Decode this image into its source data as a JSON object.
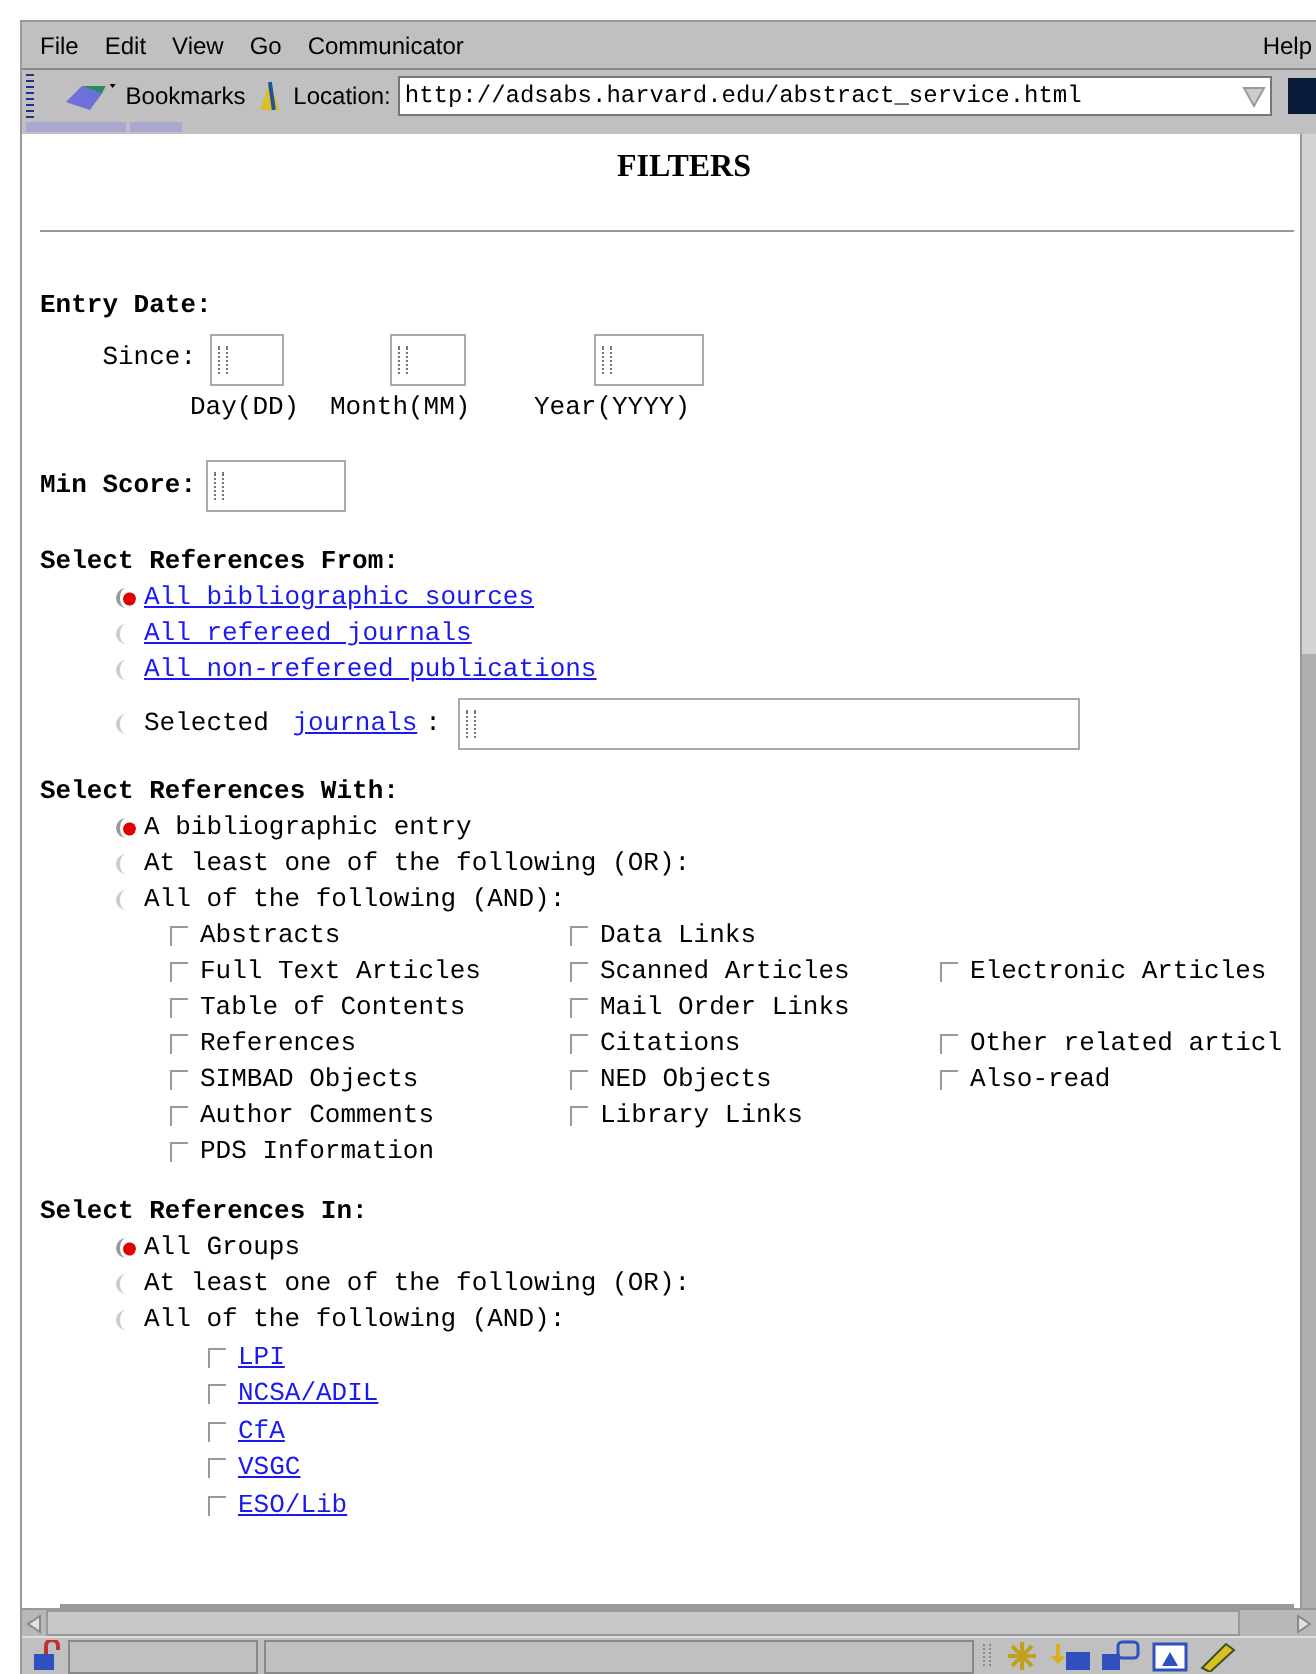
{
  "menu": [
    "File",
    "Edit",
    "View",
    "Go",
    "Communicator"
  ],
  "help_menu": "Help",
  "toolbar": {
    "bookmarks": "Bookmarks",
    "location_label": "Location:",
    "url": "http://adsabs.harvard.edu/abstract_service.html"
  },
  "title": "FILTERS",
  "entry_date": {
    "heading": "Entry Date:",
    "since_label": "Since:",
    "fields": [
      {
        "caption": "Day(DD)"
      },
      {
        "caption": "Month(MM)"
      },
      {
        "caption": "Year(YYYY)"
      }
    ]
  },
  "min_score": {
    "label": "Min Score:"
  },
  "references_from": {
    "heading": "Select References From:",
    "options": [
      {
        "kind": "link",
        "label": "All bibliographic sources",
        "selected": true
      },
      {
        "kind": "link",
        "label": "All refereed journals",
        "selected": false
      },
      {
        "kind": "link",
        "label": "All non-refereed publications",
        "selected": false
      },
      {
        "kind": "field",
        "label": "Selected ",
        "link": "journals",
        "suffix": ":",
        "selected": false
      }
    ]
  },
  "references_with": {
    "heading": "Select References With:",
    "options": [
      {
        "label": "A bibliographic entry",
        "selected": true
      },
      {
        "label": "At least one of the following (OR):",
        "selected": false
      },
      {
        "label": "All of the following (AND):",
        "selected": false
      }
    ],
    "rows": [
      {
        "cells": [
          {
            "label": "Abstracts",
            "checked": false
          },
          {
            "label": "Data Links",
            "checked": false
          }
        ]
      },
      {
        "cells": [
          {
            "label": "Full Text Articles",
            "checked": false
          },
          {
            "label": "Scanned Articles",
            "checked": false
          },
          {
            "label": "Electronic Articles",
            "checked": false
          }
        ]
      },
      {
        "cells": [
          {
            "label": "Table of Contents",
            "checked": false
          },
          {
            "label": "Mail Order Links",
            "checked": false
          }
        ]
      },
      {
        "cells": [
          {
            "label": "References",
            "checked": false
          },
          {
            "label": "Citations",
            "checked": false
          },
          {
            "label": "Other related articl",
            "checked": false
          }
        ]
      },
      {
        "cells": [
          {
            "label": "SIMBAD Objects",
            "checked": false
          },
          {
            "label": "NED Objects",
            "checked": false
          },
          {
            "label": "Also-read",
            "checked": false
          }
        ]
      },
      {
        "cells": [
          {
            "label": "Author Comments",
            "checked": false
          },
          {
            "label": "Library Links",
            "checked": false
          }
        ]
      },
      {
        "cells": [
          {
            "label": "PDS Information",
            "checked": false
          }
        ]
      }
    ]
  },
  "references_in": {
    "heading": "Select References In:",
    "options": [
      {
        "label": "All Groups",
        "selected": true
      },
      {
        "label": "At least one of the following (OR):",
        "selected": false
      },
      {
        "label": "All of the following (AND):",
        "selected": false
      }
    ],
    "groups": [
      {
        "label": "LPI",
        "checked": false
      },
      {
        "label": "NCSA/ADIL",
        "checked": false
      },
      {
        "label": "CfA",
        "checked": false
      },
      {
        "label": "VSGC",
        "checked": false
      },
      {
        "label": "ESO/Lib",
        "checked": false
      }
    ]
  }
}
